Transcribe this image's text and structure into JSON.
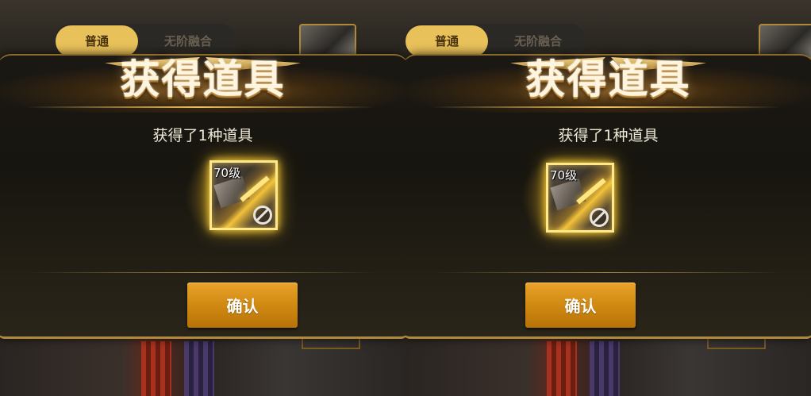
{
  "background": {
    "tab_active": "普通",
    "tab_inactive": "无阶融合"
  },
  "dialog": {
    "title": "获得道具",
    "subtitle": "获得了1种道具",
    "item": {
      "level": "70级",
      "status_icon": "banned-icon"
    },
    "confirm_label": "确认"
  },
  "colors": {
    "accent_gold": "#f0c060",
    "button_orange": "#d08a12",
    "item_glow": "#ffd23a"
  }
}
